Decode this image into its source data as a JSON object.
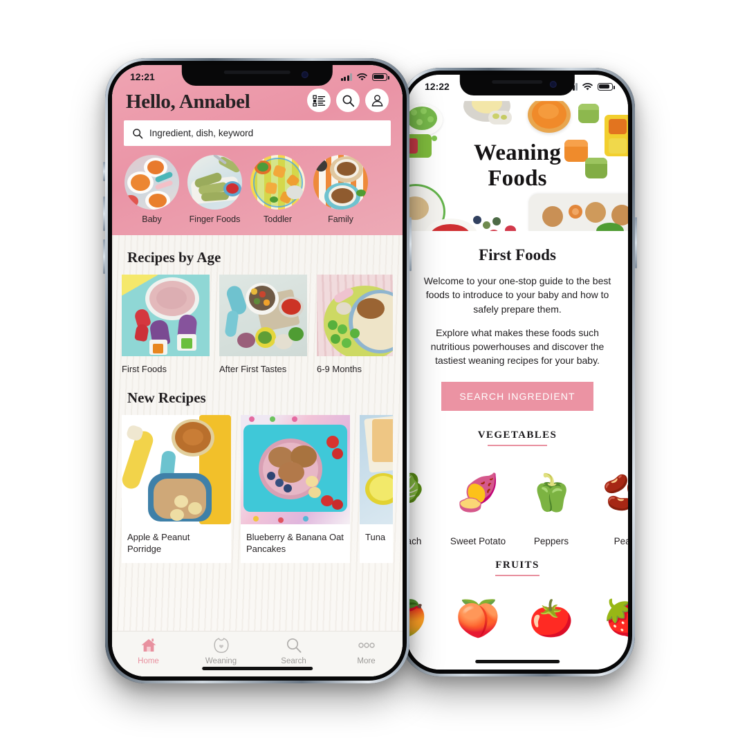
{
  "meta": {
    "brand_pink": "#eb93a3",
    "header_pink": "#ea94a6",
    "text_dark": "#231f21"
  },
  "phone_left": {
    "status": {
      "time": "12:21",
      "signal_icon": "cellular-bars-icon",
      "wifi_icon": "wifi-icon",
      "battery_icon": "battery-icon"
    },
    "header": {
      "greeting": "Hello, Annabel",
      "actions": [
        {
          "name": "checklist-icon",
          "label": "Checklist"
        },
        {
          "name": "search-icon",
          "label": "Search"
        },
        {
          "name": "profile-icon",
          "label": "Profile"
        }
      ]
    },
    "search": {
      "placeholder": "Ingredient, dish, keyword",
      "icon": "search-icon"
    },
    "categories": [
      {
        "label": "Baby"
      },
      {
        "label": "Finger Foods"
      },
      {
        "label": "Toddler"
      },
      {
        "label": "Family"
      }
    ],
    "sections": [
      {
        "title": "Recipes by Age",
        "cards": [
          {
            "label": "First Foods"
          },
          {
            "label": "After First Tastes"
          },
          {
            "label": "6-9 Months"
          }
        ]
      },
      {
        "title": "New Recipes",
        "cards": [
          {
            "label": "Apple & Peanut Porridge"
          },
          {
            "label": "Blueberry & Banana Oat Pancakes"
          },
          {
            "label": "Tuna"
          }
        ]
      }
    ],
    "tabbar": [
      {
        "label": "Home",
        "icon": "home-icon",
        "active": true
      },
      {
        "label": "Weaning",
        "icon": "bib-icon",
        "active": false
      },
      {
        "label": "Search",
        "icon": "search-icon",
        "active": false
      },
      {
        "label": "More",
        "icon": "more-dots-icon",
        "active": false
      }
    ]
  },
  "phone_right": {
    "status": {
      "time": "12:22",
      "signal_icon": "cellular-bars-icon",
      "wifi_icon": "wifi-icon",
      "battery_icon": "battery-icon"
    },
    "hero": {
      "line1": "Weaning",
      "line2": "Foods"
    },
    "title": "First Foods",
    "paragraph1": "Welcome to your one-stop guide to the best foods to introduce to your baby and how to safely prepare them.",
    "paragraph2": "Explore what makes these foods such nutritious powerhouses and discover the tastiest weaning recipes for your baby.",
    "cta": "SEARCH INGREDIENT",
    "groups": [
      {
        "heading": "VEGETABLES",
        "items": [
          {
            "name": "Spinach",
            "glyph": "🥬"
          },
          {
            "name": "Sweet Potato",
            "glyph": "🍠"
          },
          {
            "name": "Peppers",
            "glyph": "🫑"
          },
          {
            "name": "Peas",
            "glyph": "🫘"
          }
        ]
      },
      {
        "heading": "FRUITS",
        "items": [
          {
            "name": "Mango",
            "glyph": "🥭"
          },
          {
            "name": "Peach",
            "glyph": "🍑"
          },
          {
            "name": "Tomato",
            "glyph": "🍅"
          },
          {
            "name": "Strawberry",
            "glyph": "🍓"
          }
        ]
      }
    ]
  }
}
